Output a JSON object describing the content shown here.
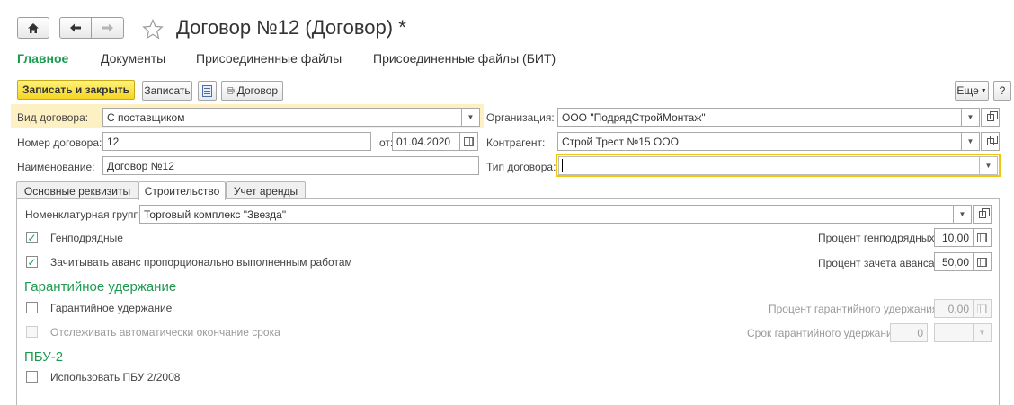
{
  "window": {
    "title": "Договор №12 (Договор) *"
  },
  "icons": {
    "home": "home-icon",
    "back": "arrow-left-icon",
    "forward": "arrow-right-icon",
    "favorite": "star-icon",
    "list": "list-icon",
    "print": "printer-icon",
    "open": "open-form-icon",
    "calendar": "calendar-icon",
    "calculator": "calculator-icon",
    "dropdown": "chevron-down-icon"
  },
  "colors": {
    "accent": "#1c9b4f",
    "primary_button": "#f5d523",
    "focus_border": "#f2c60f",
    "highlight": "#fdf0c2"
  },
  "nav_tabs": [
    "Главное",
    "Документы",
    "Присоединенные файлы",
    "Присоединенные файлы (БИТ)"
  ],
  "toolbar": {
    "save_close": "Записать и закрыть",
    "save": "Записать",
    "print": "Договор",
    "more": "Еще",
    "help": "?"
  },
  "form": {
    "contract_kind_label": "Вид договора:",
    "contract_kind_value": "С поставщиком",
    "number_label": "Номер договора:",
    "number_value": "12",
    "date_label": "от:",
    "date_value": "01.04.2020",
    "name_label": "Наименование:",
    "name_value": "Договор №12",
    "org_label": "Организация:",
    "org_value": "ООО \"ПодрядСтройМонтаж\"",
    "counterparty_label": "Контрагент:",
    "counterparty_value": "Строй Трест №15 ООО",
    "type_label": "Тип договора:",
    "type_value": ""
  },
  "tabs": [
    "Основные реквизиты",
    "Строительство",
    "Учет аренды"
  ],
  "construction": {
    "nomenclature_label": "Номенклатурная группа:",
    "nomenclature_value": "Торговый комплекс \"Звезда\"",
    "general_contract_label": "Генподрядные",
    "general_contract_checked": true,
    "general_percent_label": "Процент генподрядных:",
    "general_percent_value": "10,00",
    "advance_label": "Зачитывать аванс пропорционально выполненным работам",
    "advance_checked": true,
    "advance_percent_label": "Процент зачета аванса:",
    "advance_percent_value": "50,00",
    "guarantee_section": "Гарантийное удержание",
    "guarantee_label": "Гарантийное удержание",
    "guarantee_checked": false,
    "guarantee_percent_label": "Процент гарантийного удержания:",
    "guarantee_percent_value": "0,00",
    "track_end_label": "Отслеживать автоматически окончание срока",
    "track_end_checked": false,
    "guarantee_term_label": "Срок гарантийного удержания:",
    "guarantee_term_value": "0",
    "pbu_section": "ПБУ-2",
    "pbu_label": "Использовать ПБУ 2/2008",
    "pbu_checked": false
  }
}
